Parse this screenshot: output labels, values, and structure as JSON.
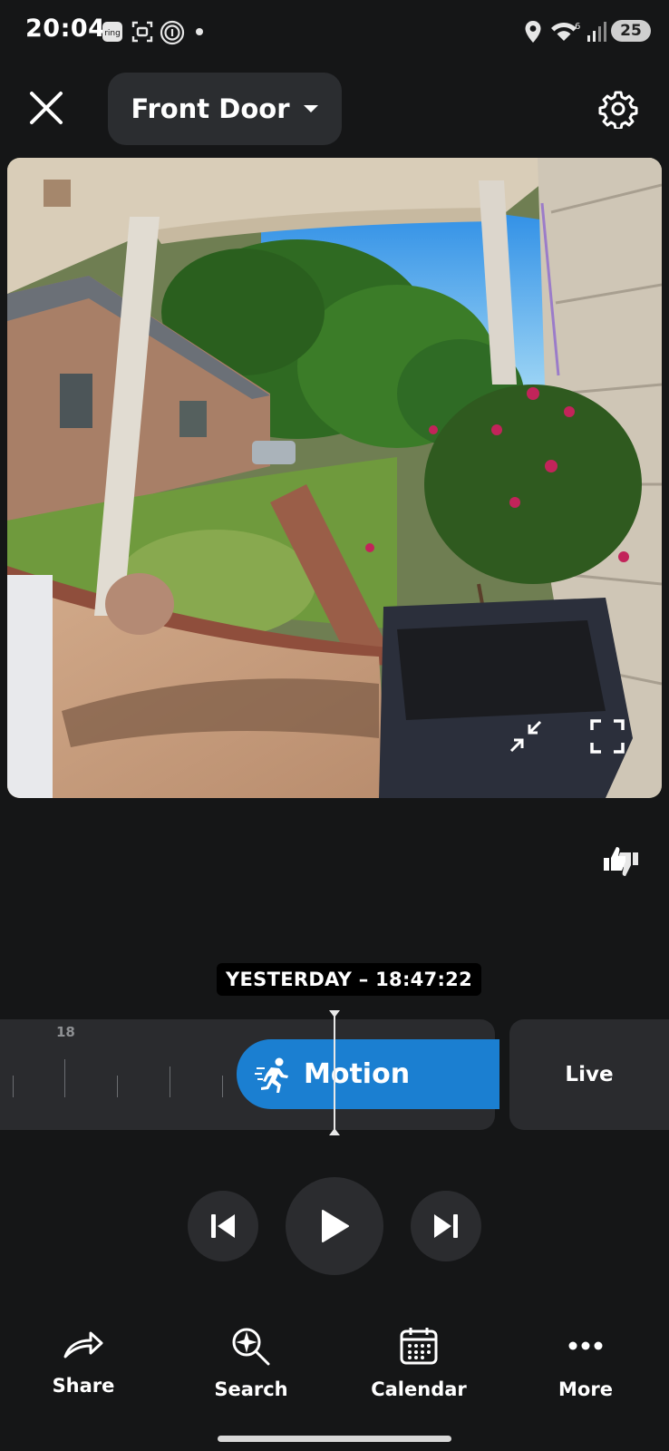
{
  "status_bar": {
    "time": "20:04",
    "left_icons": [
      "ring-app-icon",
      "screenshot-icon",
      "wifi-calling-icon",
      "dot-icon"
    ],
    "right_icons": [
      "location-icon",
      "wifi-icon",
      "signal-icon"
    ],
    "wifi_badge": "6",
    "battery": "25"
  },
  "header": {
    "device_name": "Front Door",
    "close_icon": "close-icon",
    "dropdown_icon": "chevron-down-icon",
    "settings_icon": "gear-icon"
  },
  "video": {
    "description_icons": [
      "exit-fullscreen-arrows-icon",
      "fullscreen-icon"
    ]
  },
  "feedback": {
    "icon": "thumbs-feedback-icon"
  },
  "timeline": {
    "timestamp": "YESTERDAY – 18:47:22",
    "hour_label": "18",
    "event_label": "Motion",
    "event_icon": "running-person-icon",
    "live_label": "Live",
    "accent_color": "#1b7fd1"
  },
  "controls": {
    "previous_icon": "skip-previous-icon",
    "play_icon": "play-icon",
    "next_icon": "skip-next-icon"
  },
  "bottom_nav": [
    {
      "label": "Share",
      "icon": "share-arrow-icon"
    },
    {
      "label": "Search",
      "icon": "smart-search-icon"
    },
    {
      "label": "Calendar",
      "icon": "calendar-icon"
    },
    {
      "label": "More",
      "icon": "more-dots-icon"
    }
  ]
}
